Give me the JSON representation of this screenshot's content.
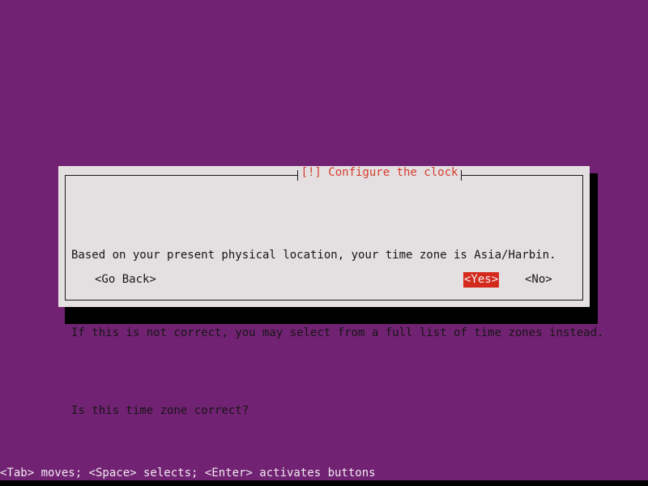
{
  "screen": {
    "background_color": "#722273",
    "bottom_strip_color": "#000000"
  },
  "dialog": {
    "title": "[!] Configure the clock",
    "title_color": "#d63c2e",
    "fill_color": "#e4e0e1",
    "border_color": "#1a1a1a",
    "shadow_color": "#000000",
    "body_lines": [
      "Based on your present physical location, your time zone is Asia/Harbin.",
      "If this is not correct, you may select from a full list of time zones instead.",
      "Is this time zone correct?"
    ],
    "buttons": [
      {
        "label": "<Go Back>",
        "selected": false
      },
      {
        "label": "<Yes>",
        "selected": true
      },
      {
        "label": "<No>",
        "selected": false
      }
    ],
    "selected_button_bg": "#d42a1e",
    "selected_button_fg": "#f4f0f0"
  },
  "helpbar": {
    "text": "<Tab> moves; <Space> selects; <Enter> activates buttons"
  }
}
